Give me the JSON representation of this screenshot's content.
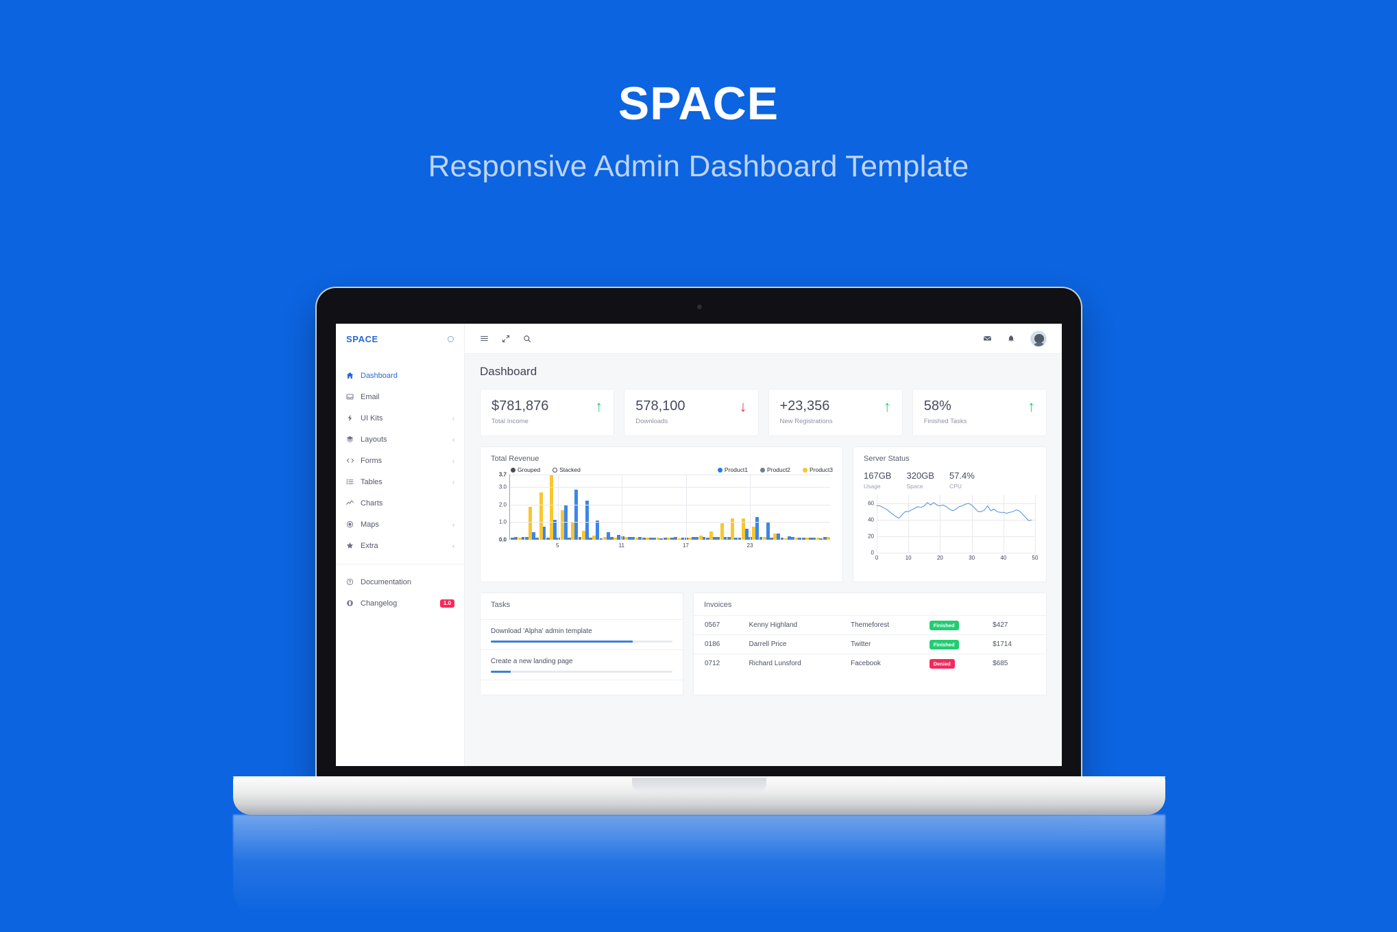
{
  "hero": {
    "title": "SPACE",
    "subtitle": "Responsive Admin Dashboard Template"
  },
  "colors": {
    "background": "#0c64e0",
    "accent": "#2668d8",
    "success": "#22cc72",
    "danger": "#f8285a",
    "product1": "#3b86e8",
    "product2": "#6e7f94",
    "product3": "#f8c62e"
  },
  "sidebar": {
    "brand": "SPACE",
    "brand_icon": "circle-icon",
    "items": [
      {
        "label": "Dashboard",
        "icon": "home-icon",
        "active": true,
        "caret": ""
      },
      {
        "label": "Email",
        "icon": "inbox-icon",
        "active": false,
        "caret": ""
      },
      {
        "label": "UI Kits",
        "icon": "bolt-icon",
        "active": false,
        "caret": "‹"
      },
      {
        "label": "Layouts",
        "icon": "layers-icon",
        "active": false,
        "caret": "‹"
      },
      {
        "label": "Forms",
        "icon": "code-icon",
        "active": false,
        "caret": "‹"
      },
      {
        "label": "Tables",
        "icon": "list-icon",
        "active": false,
        "caret": "‹"
      },
      {
        "label": "Charts",
        "icon": "line-chart-icon",
        "active": false,
        "caret": ""
      },
      {
        "label": "Maps",
        "icon": "target-icon",
        "active": false,
        "caret": "‹"
      },
      {
        "label": "Extra",
        "icon": "star-icon",
        "active": false,
        "caret": "‹"
      }
    ],
    "footer_items": [
      {
        "label": "Documentation",
        "icon": "question-circle-icon",
        "badge": ""
      },
      {
        "label": "Changelog",
        "icon": "globe-icon",
        "badge": "1.0"
      }
    ]
  },
  "topbar": {
    "menu_icon": "hamburger-icon",
    "expand_icon": "expand-arrows-icon",
    "search_icon": "search-icon",
    "mail_icon": "envelope-icon",
    "bell_icon": "bell-icon",
    "avatar": "user-avatar"
  },
  "page": {
    "title": "Dashboard"
  },
  "stats": [
    {
      "value": "$781,876",
      "label": "Total Income",
      "trend": "up",
      "arrow": "↑"
    },
    {
      "value": "578,100",
      "label": "Downloads",
      "trend": "down",
      "arrow": "↓"
    },
    {
      "value": "+23,356",
      "label": "New Registrations",
      "trend": "up",
      "arrow": "↑"
    },
    {
      "value": "58%",
      "label": "Finished Tasks",
      "trend": "up",
      "arrow": "↑"
    }
  ],
  "revenue": {
    "title": "Total Revenue",
    "mode_options": [
      {
        "label": "Grouped",
        "selected": true
      },
      {
        "label": "Stacked",
        "selected": false
      }
    ],
    "series_legend": [
      {
        "label": "Product1",
        "color": "#3b86e8"
      },
      {
        "label": "Product2",
        "color": "#6e7f94"
      },
      {
        "label": "Product3",
        "color": "#f8c62e"
      }
    ]
  },
  "server": {
    "title": "Server Status",
    "metrics": [
      {
        "value": "167GB",
        "label": "Usage"
      },
      {
        "value": "320GB",
        "label": "Space"
      },
      {
        "value": "57.4%",
        "label": "CPU"
      }
    ]
  },
  "tasks": {
    "title": "Tasks",
    "items": [
      {
        "name": "Download 'Alpha' admin template",
        "progress": 78
      },
      {
        "name": "Create a new landing page",
        "progress": 11
      }
    ]
  },
  "invoices": {
    "title": "Invoices",
    "rows": [
      {
        "id": "0567",
        "name": "Kenny Highland",
        "source": "Themeforest",
        "status": "Finished",
        "status_kind": "finished",
        "amount": "$427"
      },
      {
        "id": "0186",
        "name": "Darrell Price",
        "source": "Twitter",
        "status": "Finished",
        "status_kind": "finished",
        "amount": "$1714"
      },
      {
        "id": "0712",
        "name": "Richard Lunsford",
        "source": "Facebook",
        "status": "Denied",
        "status_kind": "denied",
        "amount": "$685"
      }
    ]
  },
  "chart_data": [
    {
      "type": "bar",
      "title": "Total Revenue",
      "xlabel": "",
      "ylabel": "",
      "ylim": [
        0,
        3.7
      ],
      "yticks": [
        "0.0",
        "1.0",
        "2.0",
        "3.0",
        "3.7"
      ],
      "xticks": [
        "5",
        "11",
        "17",
        "23"
      ],
      "xtick_positions": [
        5,
        11,
        17,
        23
      ],
      "grid": true,
      "legend": [
        "Product1",
        "Product2",
        "Product3"
      ],
      "colors": [
        "#3b86e8",
        "#6e7f94",
        "#f8c62e"
      ],
      "categories": [
        1,
        2,
        3,
        4,
        5,
        6,
        7,
        8,
        9,
        10,
        11,
        12,
        13,
        14,
        15,
        16,
        17,
        18,
        19,
        20,
        21,
        22,
        23,
        24,
        25,
        26,
        27,
        28,
        29,
        30
      ],
      "series": [
        {
          "name": "Product1",
          "values": [
            0.1,
            0.16,
            0.41,
            0.73,
            1.12,
            1.93,
            2.83,
            2.24,
            1.09,
            0.42,
            0.26,
            0.15,
            0.14,
            0.1,
            0.09,
            0.1,
            0.11,
            0.14,
            0.15,
            0.14,
            0.16,
            0.1,
            0.62,
            1.3,
            0.97,
            0.35,
            0.18,
            0.13,
            0.11,
            0.09
          ]
        },
        {
          "name": "Product2",
          "values": [
            0.15,
            0.14,
            0.1,
            0.1,
            0.13,
            0.11,
            0.16,
            0.12,
            0.09,
            0.14,
            0.18,
            0.15,
            0.13,
            0.1,
            0.12,
            0.14,
            0.12,
            0.15,
            0.13,
            0.16,
            0.14,
            0.12,
            0.15,
            0.14,
            0.1,
            0.13,
            0.14,
            0.12,
            0.13,
            0.14
          ]
        },
        {
          "name": "Product3",
          "values": [
            0.12,
            1.87,
            2.68,
            3.7,
            1.67,
            1.01,
            0.51,
            0.25,
            0.15,
            0.12,
            0.16,
            0.12,
            0.1,
            0.13,
            0.11,
            0.09,
            0.12,
            0.24,
            0.46,
            0.95,
            1.22,
            1.22,
            0.75,
            0.16,
            0.36,
            0.09,
            0.12,
            0.1,
            0.13,
            0.16
          ]
        }
      ]
    },
    {
      "type": "line",
      "title": "Server Status",
      "xlabel": "",
      "ylabel": "",
      "ylim": [
        0,
        70
      ],
      "yticks": [
        "0",
        "20",
        "40",
        "60"
      ],
      "xlim": [
        0,
        50
      ],
      "xticks": [
        "0",
        "10",
        "20",
        "30",
        "40",
        "50"
      ],
      "grid": true,
      "color": "#3b7fd8",
      "x": [
        0,
        1,
        2,
        3,
        4,
        5,
        6,
        7,
        8,
        9,
        10,
        11,
        12,
        13,
        14,
        15,
        16,
        17,
        18,
        19,
        20,
        21,
        22,
        23,
        24,
        25,
        26,
        27,
        28,
        29,
        30,
        31,
        32,
        33,
        34,
        35,
        36,
        37,
        38,
        39,
        40,
        41,
        42,
        43,
        44,
        45,
        46,
        47,
        48,
        49
      ],
      "values": [
        57,
        57,
        55,
        53,
        50,
        47,
        44,
        42,
        46,
        50,
        50,
        52,
        54,
        56,
        55,
        57,
        61,
        58,
        61,
        58,
        57,
        58,
        56,
        53,
        51,
        53,
        56,
        57,
        59,
        60,
        58,
        54,
        50,
        50,
        52,
        57,
        51,
        53,
        50,
        49,
        49,
        48,
        49,
        50,
        52,
        51,
        47,
        43,
        39,
        40
      ]
    }
  ]
}
